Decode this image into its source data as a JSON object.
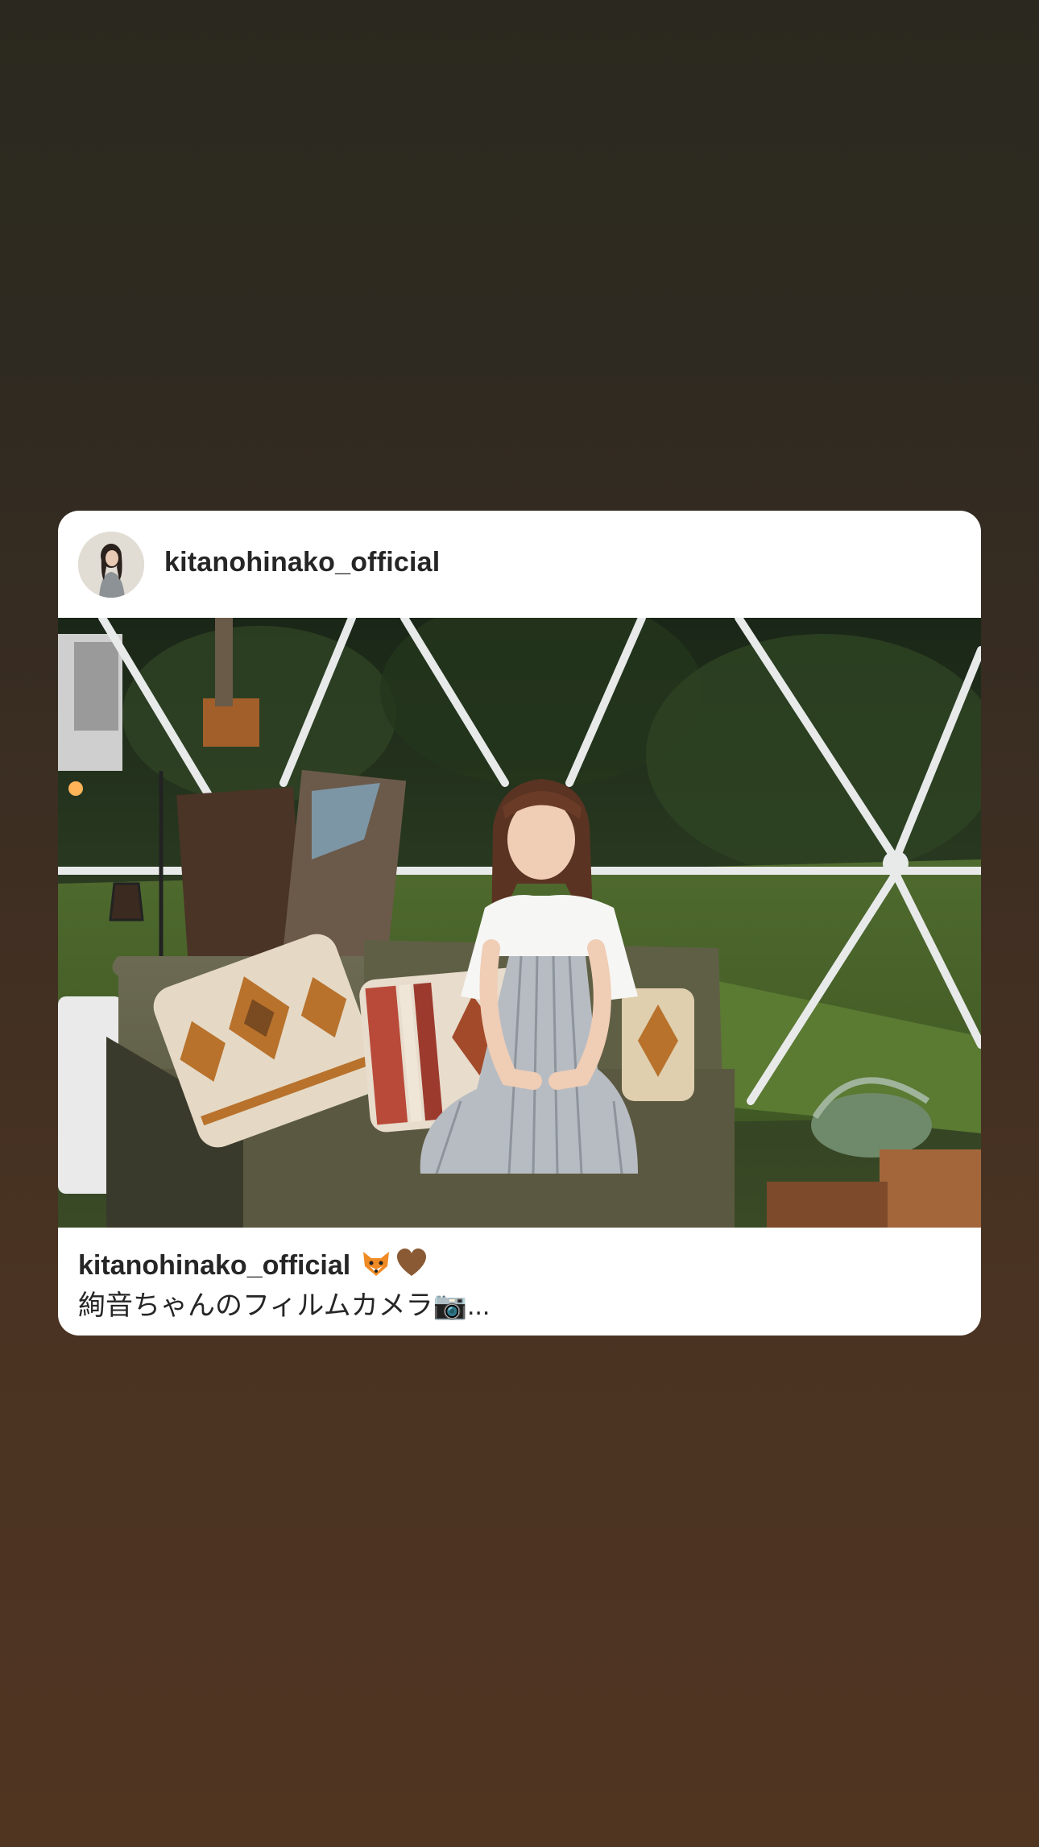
{
  "post": {
    "username": "kitanohinako_official",
    "caption_user": "kitanohinako_official",
    "caption_text": "絢音ちゃんのフィルムカメラ📷..."
  },
  "icons": {
    "caption_emoji_1": "fox-emoji",
    "caption_emoji_2": "brown-heart-emoji"
  },
  "colors": {
    "card_background": "#ffffff",
    "text": "#262626",
    "page_gradient_top": "#2b291f",
    "page_gradient_bottom": "#503521"
  }
}
